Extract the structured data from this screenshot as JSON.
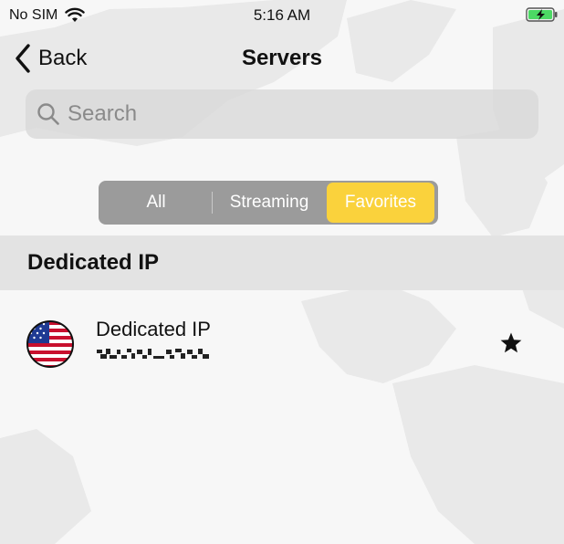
{
  "status_bar": {
    "carrier": "No SIM",
    "time": "5:16 AM",
    "icons": [
      "wifi-icon",
      "battery-charging-icon"
    ]
  },
  "nav": {
    "back_label": "Back",
    "title": "Servers"
  },
  "search": {
    "placeholder": "Search",
    "value": ""
  },
  "segments": [
    {
      "label": "All",
      "selected": false
    },
    {
      "label": "Streaming",
      "selected": false
    },
    {
      "label": "Favorites",
      "selected": true
    }
  ],
  "section": {
    "title": "Dedicated IP"
  },
  "servers": [
    {
      "name": "Dedicated IP",
      "ip_obscured": true,
      "favorite": true,
      "flag_icon": "us-flag-icon"
    }
  ],
  "colors": {
    "accent": "#fad23c",
    "segment_bg": "#9b9b9b",
    "section_bg": "#e3e3e3",
    "battery_green": "#4cd964"
  }
}
